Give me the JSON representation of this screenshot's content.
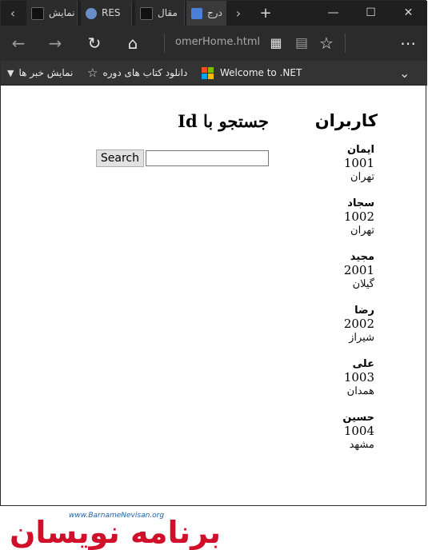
{
  "tabs": [
    {
      "label": "نمایش",
      "icon": "vs-icon",
      "active": false
    },
    {
      "label": "RES",
      "icon": "cloud-icon",
      "active": false
    },
    {
      "label": "مقال",
      "icon": "vs-icon",
      "active": false
    },
    {
      "label": "درج",
      "icon": "translate-icon",
      "active": true
    }
  ],
  "address": {
    "url": "omerHome.html"
  },
  "favorites": [
    {
      "label": "Welcome to .NET",
      "icon": "microsoft-logo-icon"
    },
    {
      "label": "دانلود کتاب های دوره",
      "icon": "star-icon"
    },
    {
      "label": "نمایش خبر ها",
      "icon": "vs-icon"
    }
  ],
  "users_section": {
    "title": "کاربران",
    "users": [
      {
        "name": "ایمان",
        "id": "1001",
        "city": "تهران"
      },
      {
        "name": "سجاد",
        "id": "1002",
        "city": "تهران"
      },
      {
        "name": "مجید",
        "id": "2001",
        "city": "گیلان"
      },
      {
        "name": "رضا",
        "id": "2002",
        "city": "شیراز"
      },
      {
        "name": "علی",
        "id": "1003",
        "city": "همدان"
      },
      {
        "name": "حسین",
        "id": "1004",
        "city": "مشهد"
      }
    ]
  },
  "search_section": {
    "title": "جستجو با Id",
    "button_label": "Search",
    "input_value": ""
  },
  "brand": {
    "site": "www.BarnameNevisan.org",
    "logo_text": "برنامه نویسان"
  },
  "colors": {
    "brand_red": "#d0102a",
    "brand_blue": "#1d5fa6",
    "chrome_dark": "#2b2b2b"
  }
}
